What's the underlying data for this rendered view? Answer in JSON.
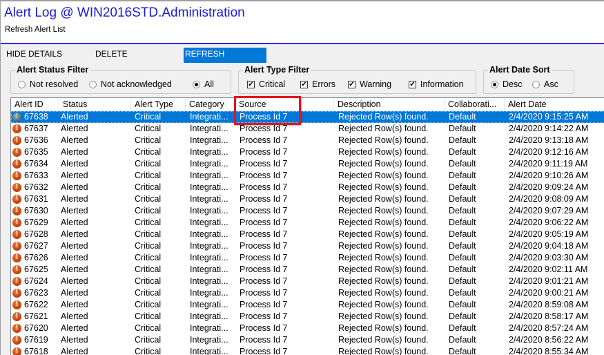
{
  "header": {
    "title": "Alert Log @ WIN2016STD.Administration",
    "subtitle": "Refresh Alert List"
  },
  "toolbar": {
    "hide_details": "HIDE DETAILS",
    "delete": "DELETE",
    "refresh": "REFRESH"
  },
  "status_filter": {
    "legend": "Alert Status Filter",
    "options": [
      {
        "label": "Not resolved",
        "selected": false
      },
      {
        "label": "Not acknowledged",
        "selected": false
      },
      {
        "label": "All",
        "selected": true
      }
    ]
  },
  "type_filter": {
    "legend": "Alert Type Filter",
    "options": [
      {
        "label": "Critical",
        "checked": true
      },
      {
        "label": "Errors",
        "checked": true
      },
      {
        "label": "Warning",
        "checked": true
      },
      {
        "label": "Information",
        "checked": true
      }
    ]
  },
  "date_sort": {
    "legend": "Alert Date Sort",
    "options": [
      {
        "label": "Desc",
        "selected": true
      },
      {
        "label": "Asc",
        "selected": false
      }
    ]
  },
  "list": {
    "columns": [
      "Alert ID",
      "Status",
      "Alert Type",
      "Category",
      "Source",
      "Description",
      "Collaborati...",
      "Alert Date"
    ],
    "selected_index": 0,
    "rows": [
      {
        "icon": "critical-alert-icon",
        "id": "67638",
        "status": "Alerted",
        "type": "Critical",
        "category": "Integrati...",
        "source": "Process Id 7",
        "description": "Rejected Row(s) found.",
        "collaboration": "Default",
        "date": "2/4/2020 9:15:25 AM"
      },
      {
        "icon": "critical-alert-icon",
        "id": "67637",
        "status": "Alerted",
        "type": "Critical",
        "category": "Integrati...",
        "source": "Process Id 7",
        "description": "Rejected Row(s) found.",
        "collaboration": "Default",
        "date": "2/4/2020 9:14:22 AM"
      },
      {
        "icon": "critical-alert-icon",
        "id": "67636",
        "status": "Alerted",
        "type": "Critical",
        "category": "Integrati...",
        "source": "Process Id 7",
        "description": "Rejected Row(s) found.",
        "collaboration": "Default",
        "date": "2/4/2020 9:13:18 AM"
      },
      {
        "icon": "critical-alert-icon",
        "id": "67635",
        "status": "Alerted",
        "type": "Critical",
        "category": "Integrati...",
        "source": "Process Id 7",
        "description": "Rejected Row(s) found.",
        "collaboration": "Default",
        "date": "2/4/2020 9:12:16 AM"
      },
      {
        "icon": "critical-alert-icon",
        "id": "67634",
        "status": "Alerted",
        "type": "Critical",
        "category": "Integrati...",
        "source": "Process Id 7",
        "description": "Rejected Row(s) found.",
        "collaboration": "Default",
        "date": "2/4/2020 9:11:19 AM"
      },
      {
        "icon": "critical-alert-icon",
        "id": "67633",
        "status": "Alerted",
        "type": "Critical",
        "category": "Integrati...",
        "source": "Process Id 7",
        "description": "Rejected Row(s) found.",
        "collaboration": "Default",
        "date": "2/4/2020 9:10:26 AM"
      },
      {
        "icon": "critical-alert-icon",
        "id": "67632",
        "status": "Alerted",
        "type": "Critical",
        "category": "Integrati...",
        "source": "Process Id 7",
        "description": "Rejected Row(s) found.",
        "collaboration": "Default",
        "date": "2/4/2020 9:09:24 AM"
      },
      {
        "icon": "critical-alert-icon",
        "id": "67631",
        "status": "Alerted",
        "type": "Critical",
        "category": "Integrati...",
        "source": "Process Id 7",
        "description": "Rejected Row(s) found.",
        "collaboration": "Default",
        "date": "2/4/2020 9:08:09 AM"
      },
      {
        "icon": "critical-alert-icon",
        "id": "67630",
        "status": "Alerted",
        "type": "Critical",
        "category": "Integrati...",
        "source": "Process Id 7",
        "description": "Rejected Row(s) found.",
        "collaboration": "Default",
        "date": "2/4/2020 9:07:29 AM"
      },
      {
        "icon": "critical-alert-icon",
        "id": "67629",
        "status": "Alerted",
        "type": "Critical",
        "category": "Integrati...",
        "source": "Process Id 7",
        "description": "Rejected Row(s) found.",
        "collaboration": "Default",
        "date": "2/4/2020 9:06:22 AM"
      },
      {
        "icon": "critical-alert-icon",
        "id": "67628",
        "status": "Alerted",
        "type": "Critical",
        "category": "Integrati...",
        "source": "Process Id 7",
        "description": "Rejected Row(s) found.",
        "collaboration": "Default",
        "date": "2/4/2020 9:05:19 AM"
      },
      {
        "icon": "critical-alert-icon",
        "id": "67627",
        "status": "Alerted",
        "type": "Critical",
        "category": "Integrati...",
        "source": "Process Id 7",
        "description": "Rejected Row(s) found.",
        "collaboration": "Default",
        "date": "2/4/2020 9:04:18 AM"
      },
      {
        "icon": "critical-alert-icon",
        "id": "67626",
        "status": "Alerted",
        "type": "Critical",
        "category": "Integrati...",
        "source": "Process Id 7",
        "description": "Rejected Row(s) found.",
        "collaboration": "Default",
        "date": "2/4/2020 9:03:30 AM"
      },
      {
        "icon": "critical-alert-icon",
        "id": "67625",
        "status": "Alerted",
        "type": "Critical",
        "category": "Integrati...",
        "source": "Process Id 7",
        "description": "Rejected Row(s) found.",
        "collaboration": "Default",
        "date": "2/4/2020 9:02:11 AM"
      },
      {
        "icon": "critical-alert-icon",
        "id": "67624",
        "status": "Alerted",
        "type": "Critical",
        "category": "Integrati...",
        "source": "Process Id 7",
        "description": "Rejected Row(s) found.",
        "collaboration": "Default",
        "date": "2/4/2020 9:01:21 AM"
      },
      {
        "icon": "critical-alert-icon",
        "id": "67623",
        "status": "Alerted",
        "type": "Critical",
        "category": "Integrati...",
        "source": "Process Id 7",
        "description": "Rejected Row(s) found.",
        "collaboration": "Default",
        "date": "2/4/2020 9:00:21 AM"
      },
      {
        "icon": "critical-alert-icon",
        "id": "67622",
        "status": "Alerted",
        "type": "Critical",
        "category": "Integrati...",
        "source": "Process Id 7",
        "description": "Rejected Row(s) found.",
        "collaboration": "Default",
        "date": "2/4/2020 8:59:08 AM"
      },
      {
        "icon": "critical-alert-icon",
        "id": "67621",
        "status": "Alerted",
        "type": "Critical",
        "category": "Integrati...",
        "source": "Process Id 7",
        "description": "Rejected Row(s) found.",
        "collaboration": "Default",
        "date": "2/4/2020 8:58:17 AM"
      },
      {
        "icon": "critical-alert-icon",
        "id": "67620",
        "status": "Alerted",
        "type": "Critical",
        "category": "Integrati...",
        "source": "Process Id 7",
        "description": "Rejected Row(s) found.",
        "collaboration": "Default",
        "date": "2/4/2020 8:57:24 AM"
      },
      {
        "icon": "critical-alert-icon",
        "id": "67619",
        "status": "Alerted",
        "type": "Critical",
        "category": "Integrati...",
        "source": "Process Id 7",
        "description": "Rejected Row(s) found.",
        "collaboration": "Default",
        "date": "2/4/2020 8:56:22 AM"
      },
      {
        "icon": "critical-alert-icon",
        "id": "67618",
        "status": "Alerted",
        "type": "Critical",
        "category": "Integrati...",
        "source": "Process Id 7",
        "description": "Rejected Row(s) found.",
        "collaboration": "Default",
        "date": "2/4/2020 8:55:34 AM"
      }
    ]
  },
  "annotation": {
    "highlight_color": "#e8121a",
    "target": "Source column header and first row"
  },
  "colors": {
    "accent": "#0078d7",
    "title": "#1a1ad6",
    "header_rule": "#2b2bd9"
  }
}
